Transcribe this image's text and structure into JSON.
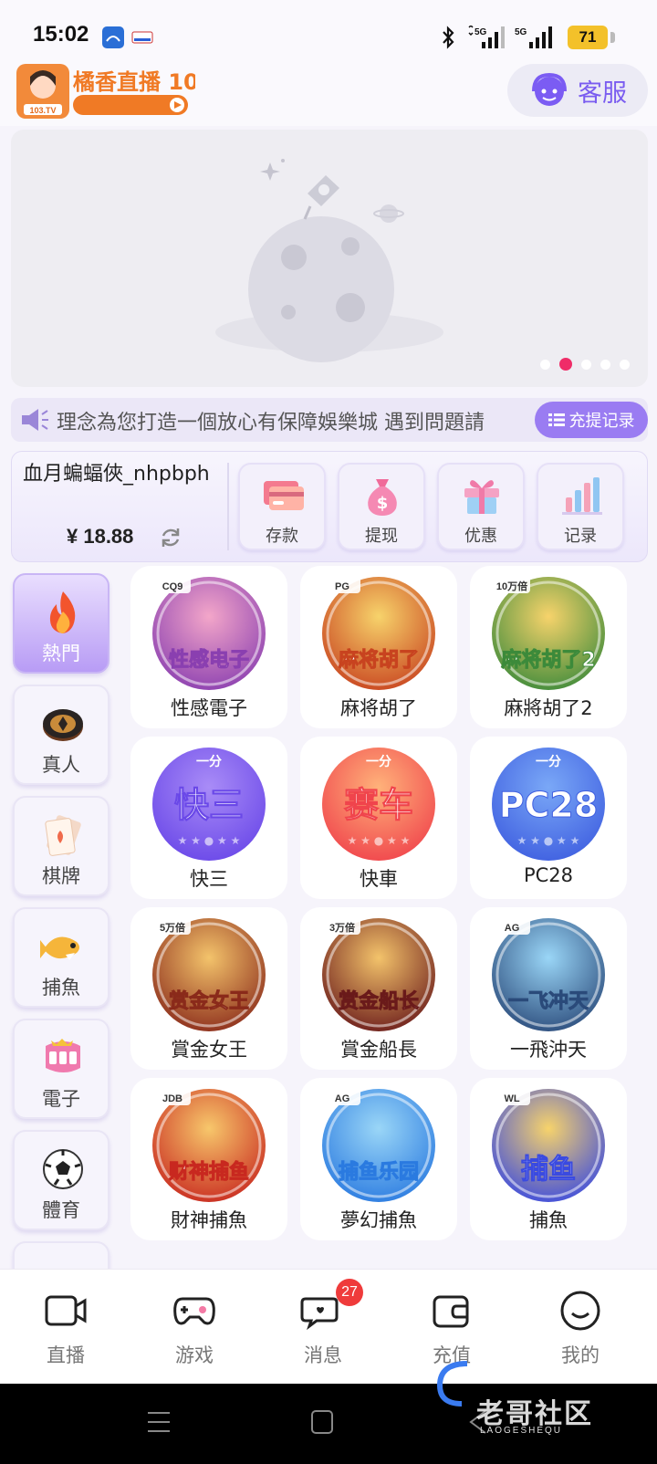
{
  "status": {
    "time": "15:02",
    "signal1": "5G",
    "signal2": "5G",
    "battery": "71"
  },
  "header": {
    "logo_text": "橘香直播 103.tv",
    "cs_label": "客服"
  },
  "banner": {
    "slide_count": 5,
    "active_slide": 2
  },
  "notice": {
    "text": "理念為您打造一個放心有保障娛樂城  遇到問題請",
    "records_label": "充提记录"
  },
  "wallet": {
    "username": "血月蝙蝠俠_nhpbph",
    "balance": "¥ 18.88",
    "actions": [
      {
        "label": "存款",
        "icon": "bank-card-icon"
      },
      {
        "label": "提现",
        "icon": "money-bag-icon"
      },
      {
        "label": "优惠",
        "icon": "gift-icon"
      },
      {
        "label": "记录",
        "icon": "bar-chart-icon"
      }
    ]
  },
  "categories": [
    {
      "label": "熱門",
      "icon": "fire-icon"
    },
    {
      "label": "真人",
      "icon": "poker-chip-icon"
    },
    {
      "label": "棋牌",
      "icon": "playing-card-icon"
    },
    {
      "label": "捕魚",
      "icon": "fish-icon"
    },
    {
      "label": "電子",
      "icon": "slot-machine-icon"
    },
    {
      "label": "體育",
      "icon": "soccer-ball-icon"
    }
  ],
  "games": [
    {
      "label": "性感電子",
      "art": "性感电子",
      "tag": "CQ9"
    },
    {
      "label": "麻将胡了",
      "art": "麻将胡了",
      "tag": "PG"
    },
    {
      "label": "麻將胡了2",
      "art": "麻将胡了2",
      "tag": "10万倍"
    },
    {
      "label": "快三",
      "art": "快三",
      "tag": "一分"
    },
    {
      "label": "快車",
      "art": "赛车",
      "tag": "一分"
    },
    {
      "label": "PC28",
      "art": "PC28",
      "tag": "一分"
    },
    {
      "label": "賞金女王",
      "art": "赏金女王",
      "tag": "5万倍"
    },
    {
      "label": "賞金船長",
      "art": "赏金船长",
      "tag": "3万倍"
    },
    {
      "label": "一飛沖天",
      "art": "一飞冲天",
      "tag": "AG"
    },
    {
      "label": "財神捕魚",
      "art": "财神捕鱼",
      "tag": "JDB"
    },
    {
      "label": "夢幻捕魚",
      "art": "捕鱼乐园",
      "tag": "AG"
    },
    {
      "label": "捕魚",
      "art": "捕鱼",
      "tag": "WL"
    }
  ],
  "tabs": [
    {
      "label": "直播",
      "icon": "video-camera-icon"
    },
    {
      "label": "游戏",
      "icon": "gamepad-icon"
    },
    {
      "label": "消息",
      "icon": "chat-bubble-icon",
      "badge": "27"
    },
    {
      "label": "充值",
      "icon": "wallet-icon"
    },
    {
      "label": "我的",
      "icon": "smiley-face-icon"
    }
  ],
  "watermark": {
    "title": "老哥社区",
    "subtitle": "LAOGESHEQU"
  }
}
